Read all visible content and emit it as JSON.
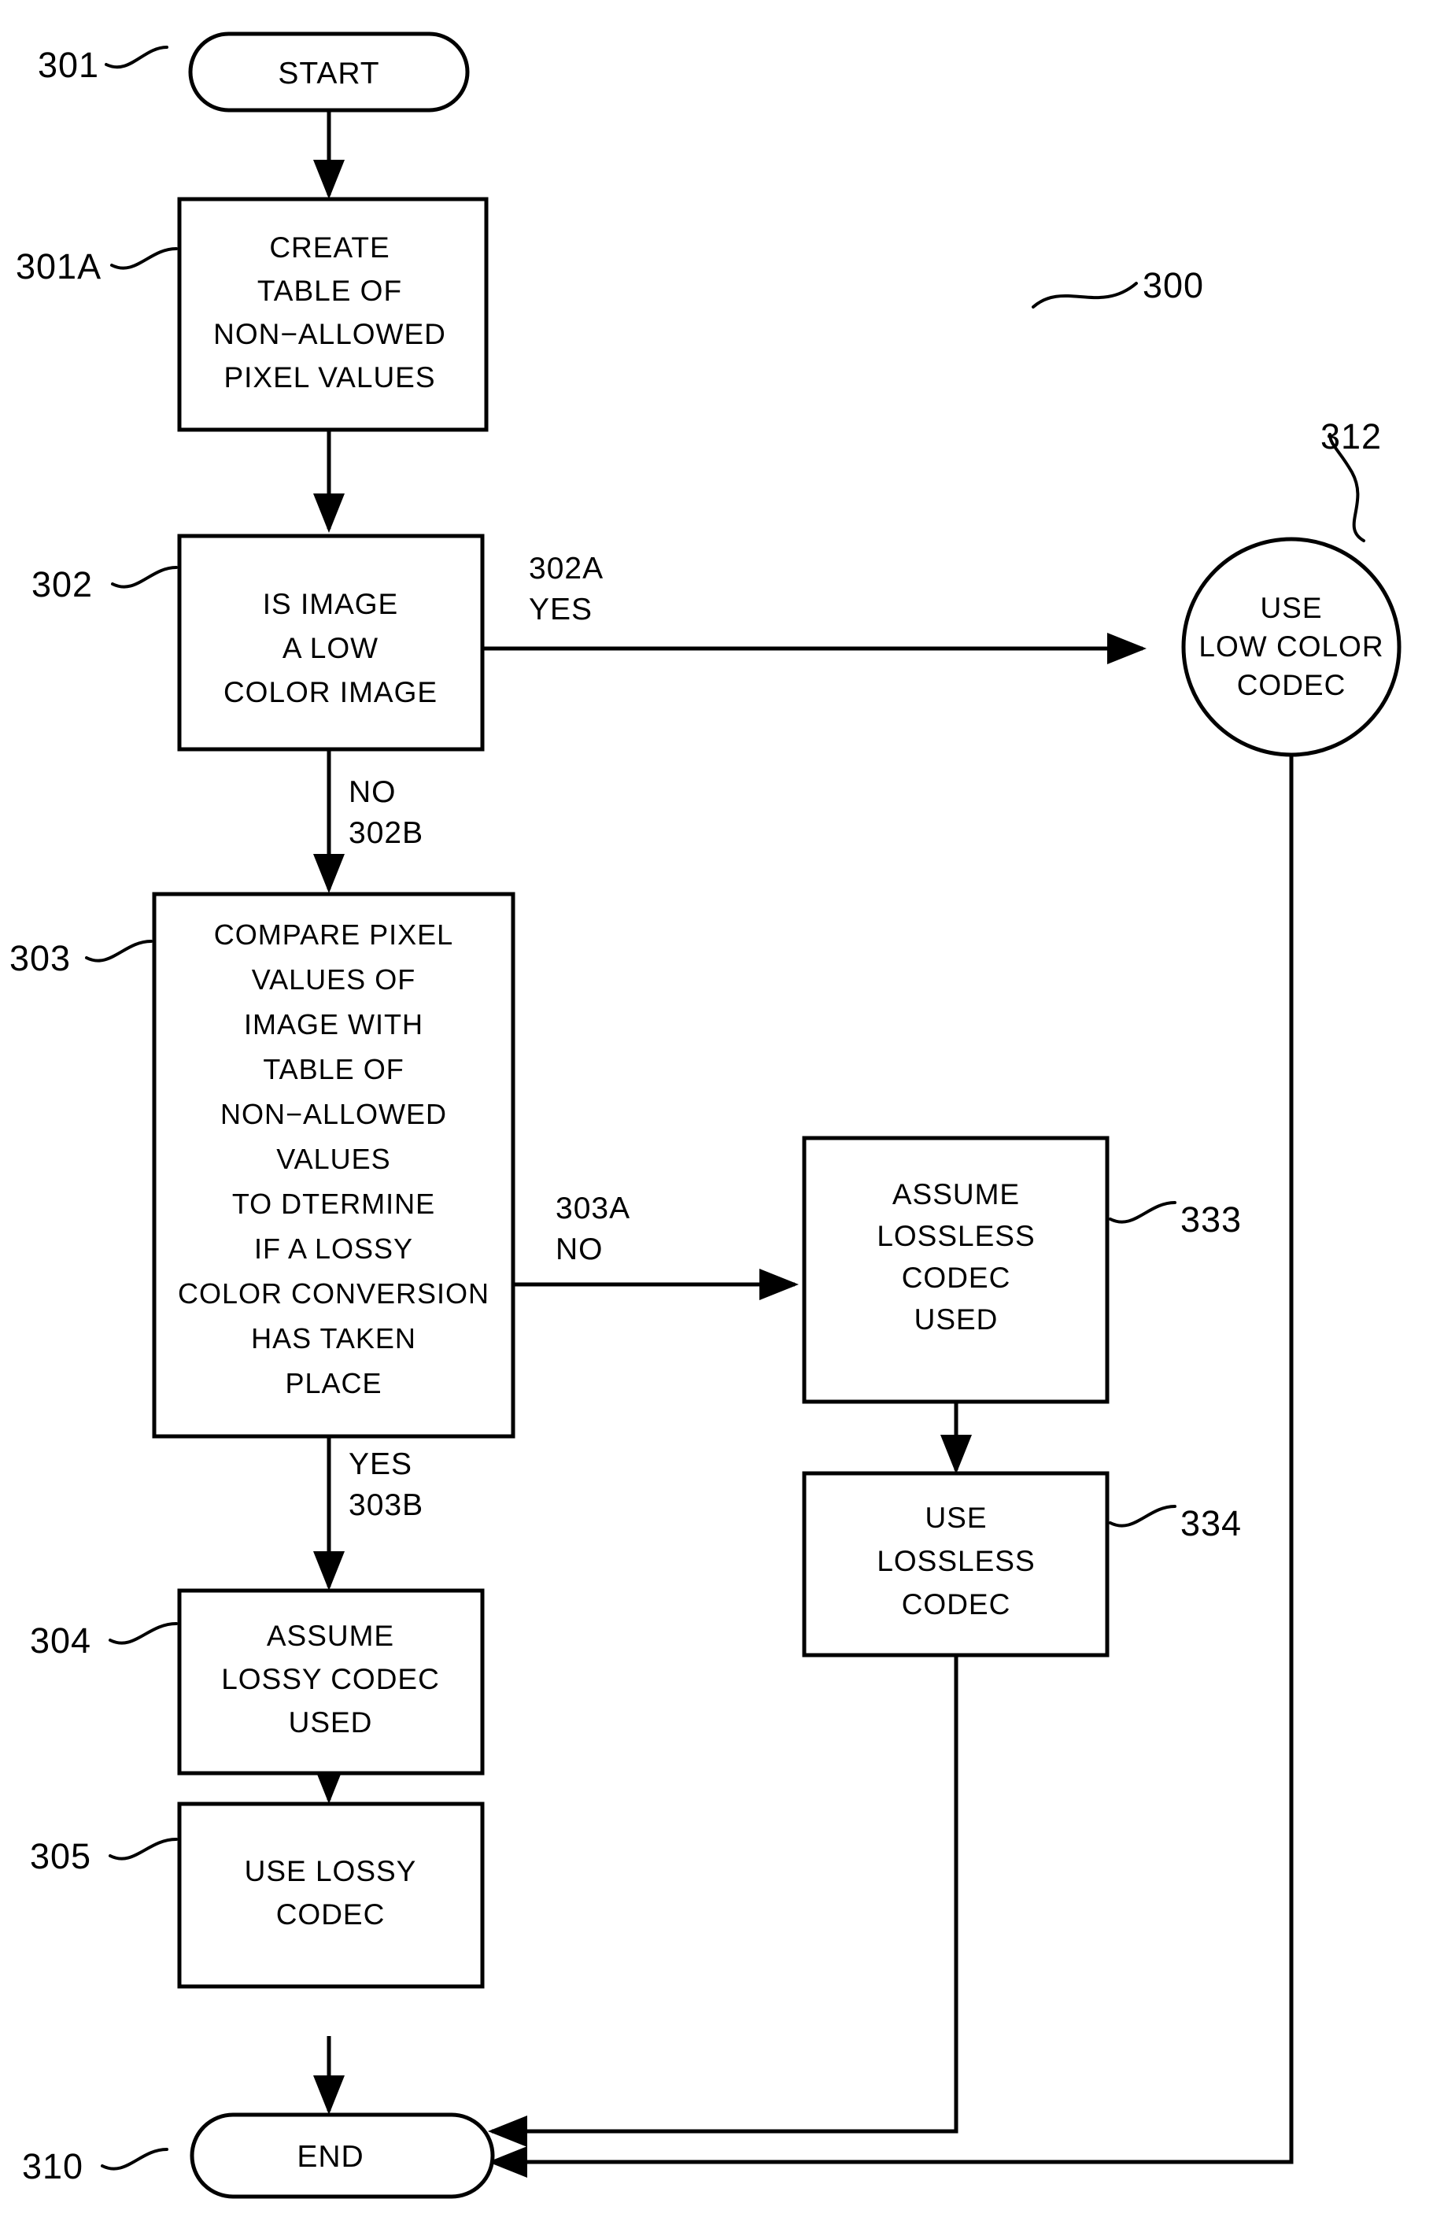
{
  "figure": {
    "number": "300",
    "type": "flowchart"
  },
  "nodes": {
    "start": {
      "ref": "301",
      "label": "START",
      "shape": "stadium"
    },
    "create_table": {
      "ref": "301A",
      "shape": "rectangle",
      "lines": [
        "CREATE",
        "TABLE OF",
        "NON−ALLOWED",
        "PIXEL VALUES"
      ]
    },
    "is_low_color": {
      "ref": "302",
      "shape": "rectangle",
      "lines": [
        "IS IMAGE",
        "A LOW",
        "COLOR IMAGE"
      ]
    },
    "low_color_codec": {
      "ref": "312",
      "shape": "circle",
      "lines": [
        "USE",
        "LOW COLOR",
        "CODEC"
      ]
    },
    "compare_pixels": {
      "ref": "303",
      "shape": "rectangle",
      "lines": [
        "COMPARE PIXEL",
        "VALUES OF",
        "IMAGE WITH",
        "TABLE OF",
        "NON−ALLOWED",
        "VALUES",
        "TO DTERMINE",
        "IF A LOSSY",
        "COLOR CONVERSION",
        "HAS TAKEN",
        "PLACE"
      ]
    },
    "assume_lossless": {
      "ref": "333",
      "shape": "rectangle",
      "lines": [
        "ASSUME",
        "LOSSLESS",
        "CODEC",
        "USED"
      ]
    },
    "use_lossless": {
      "ref": "334",
      "shape": "rectangle",
      "lines": [
        "USE",
        "LOSSLESS",
        "CODEC"
      ]
    },
    "assume_lossy": {
      "ref": "304",
      "shape": "rectangle",
      "lines": [
        "ASSUME",
        "LOSSY CODEC",
        "USED"
      ]
    },
    "use_lossy": {
      "ref": "305",
      "shape": "rectangle",
      "lines": [
        "USE LOSSY",
        "CODEC"
      ]
    },
    "end": {
      "ref": "310",
      "label": "END",
      "shape": "stadium"
    }
  },
  "edge_labels": {
    "yes_302a": {
      "ref": "302A",
      "answer": "YES"
    },
    "no_302b": {
      "answer": "NO",
      "ref": "302B"
    },
    "no_303a": {
      "ref": "303A",
      "answer": "NO"
    },
    "yes_303b": {
      "answer": "YES",
      "ref": "303B"
    }
  },
  "colors": {
    "stroke": "#000000",
    "fill": "#ffffff",
    "background": "#ffffff"
  }
}
